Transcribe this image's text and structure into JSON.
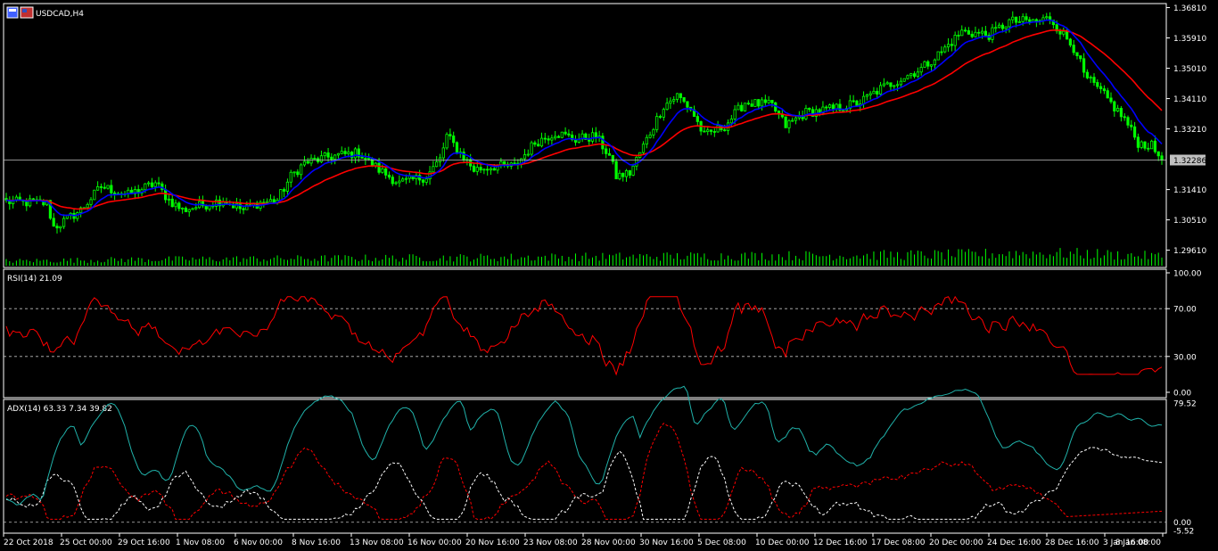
{
  "window": {
    "title": "USDCAD,H4",
    "icon_names": [
      "chart-window-icon",
      "flag-icon"
    ]
  },
  "colors": {
    "background": "#000000",
    "frame": "#ffffff",
    "candle": "#00ff00",
    "volume": "#00ff00",
    "ma_fast": "#0000ff",
    "ma_slow": "#ff0000",
    "price_line": "#c0c0c0",
    "rsi": "#ff0000",
    "levels": "#c0c0c0",
    "adx_main": "#20b2aa",
    "adx_plus_di": "#ffffff",
    "adx_minus_di": "#ff0000",
    "price_box_bg": "#c0c0c0"
  },
  "chart_data": [
    {
      "type": "candlestick",
      "title": "USDCAD,H4",
      "symbol": "USDCAD",
      "timeframe": "H4",
      "y_ticks": [
        "1.36810",
        "1.35910",
        "1.35010",
        "1.34110",
        "1.33210",
        "1.32286",
        "1.31410",
        "1.30510",
        "1.29610"
      ],
      "current_price": "1.32286",
      "ylim": [
        1.2915,
        1.3693
      ],
      "x_ticks": [
        "22 Oct 2018",
        "25 Oct 00:00",
        "29 Oct 16:00",
        "1 Nov 08:00",
        "6 Nov 00:00",
        "8 Nov 16:00",
        "13 Nov 08:00",
        "16 Nov 00:00",
        "20 Nov 16:00",
        "23 Nov 08:00",
        "28 Nov 00:00",
        "30 Nov 16:00",
        "5 Dec 08:00",
        "10 Dec 00:00",
        "12 Dec 16:00",
        "17 Dec 08:00",
        "20 Dec 00:00",
        "24 Dec 16:00",
        "28 Dec 16:00",
        "3 Jan 16:00",
        "8 Jan 08:00"
      ],
      "close_anchors": [
        [
          0,
          1.3105
        ],
        [
          12,
          1.31
        ],
        [
          14,
          1.303
        ],
        [
          16,
          1.304
        ],
        [
          22,
          1.308
        ],
        [
          28,
          1.315
        ],
        [
          36,
          1.3125
        ],
        [
          44,
          1.316
        ],
        [
          48,
          1.311
        ],
        [
          52,
          1.308
        ],
        [
          56,
          1.309
        ],
        [
          64,
          1.311
        ],
        [
          70,
          1.308
        ],
        [
          74,
          1.31
        ],
        [
          80,
          1.311
        ],
        [
          84,
          1.318
        ],
        [
          88,
          1.322
        ],
        [
          96,
          1.324
        ],
        [
          104,
          1.325
        ],
        [
          110,
          1.32
        ],
        [
          116,
          1.316
        ],
        [
          124,
          1.318
        ],
        [
          128,
          1.323
        ],
        [
          130,
          1.33
        ],
        [
          134,
          1.325
        ],
        [
          138,
          1.32
        ],
        [
          144,
          1.321
        ],
        [
          150,
          1.321
        ],
        [
          156,
          1.328
        ],
        [
          162,
          1.331
        ],
        [
          168,
          1.329
        ],
        [
          174,
          1.33
        ],
        [
          178,
          1.324
        ],
        [
          180,
          1.318
        ],
        [
          184,
          1.319
        ],
        [
          188,
          1.327
        ],
        [
          194,
          1.339
        ],
        [
          198,
          1.342
        ],
        [
          202,
          1.338
        ],
        [
          206,
          1.33
        ],
        [
          212,
          1.333
        ],
        [
          218,
          1.34
        ],
        [
          226,
          1.339
        ],
        [
          230,
          1.333
        ],
        [
          236,
          1.337
        ],
        [
          244,
          1.338
        ],
        [
          252,
          1.34
        ],
        [
          258,
          1.344
        ],
        [
          264,
          1.347
        ],
        [
          270,
          1.35
        ],
        [
          276,
          1.355
        ],
        [
          282,
          1.361
        ],
        [
          290,
          1.36
        ],
        [
          296,
          1.364
        ],
        [
          304,
          1.364
        ],
        [
          308,
          1.365
        ],
        [
          312,
          1.36
        ],
        [
          316,
          1.355
        ],
        [
          318,
          1.348
        ],
        [
          324,
          1.342
        ],
        [
          330,
          1.335
        ],
        [
          334,
          1.328
        ],
        [
          338,
          1.327
        ],
        [
          341,
          1.3229
        ]
      ],
      "volume_anchors": [
        [
          0,
          0.3
        ],
        [
          40,
          0.4
        ],
        [
          80,
          0.45
        ],
        [
          120,
          0.5
        ],
        [
          160,
          0.55
        ],
        [
          200,
          0.6
        ],
        [
          240,
          0.65
        ],
        [
          280,
          0.7
        ],
        [
          300,
          0.8
        ],
        [
          320,
          0.75
        ],
        [
          341,
          0.6
        ]
      ],
      "ma_fast_period": 10,
      "ma_slow_period": 30
    },
    {
      "type": "line",
      "title": "RSI(14) 21.09",
      "indicator": "RSI",
      "period": 14,
      "last_value": 21.09,
      "y_ticks": [
        "100.00",
        "70.00",
        "30.00",
        "0.00"
      ],
      "levels": [
        70,
        30
      ],
      "ylim": [
        0,
        100
      ]
    },
    {
      "type": "line",
      "title": "ADX(14) 63.33 7.34 39.82",
      "indicator": "ADX",
      "period": 14,
      "last_values": {
        "adx": 63.33,
        "minus_di": 7.34,
        "plus_di": 39.82
      },
      "y_ticks": [
        "79.52",
        "0.00",
        "-5.52"
      ],
      "ylim": [
        -5.52,
        79.52
      ]
    }
  ]
}
